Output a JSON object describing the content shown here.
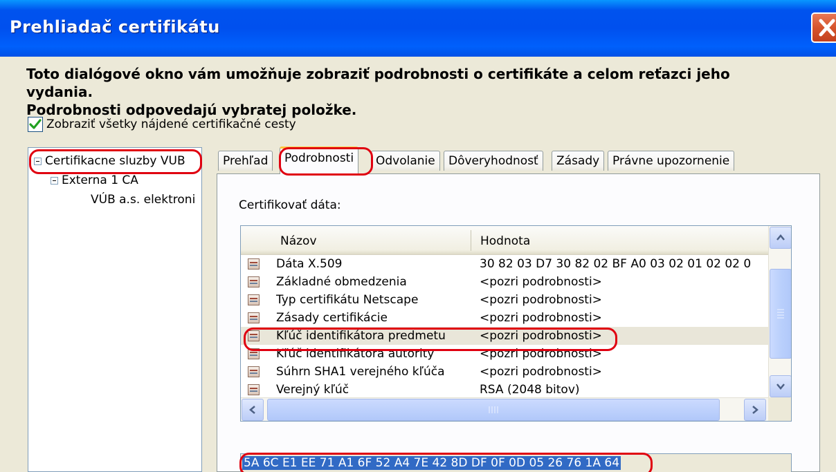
{
  "window": {
    "title": "Prehliadač certifikátu"
  },
  "description": {
    "line1": "Toto dialógové okno vám umožňuje zobraziť podrobnosti o certifikáte a celom reťazci jeho vydania.",
    "line2": "Podrobnosti odpovedajú vybratej položke."
  },
  "checkbox": {
    "label": "Zobraziť všetky nájdené certifikačné cesty",
    "checked": true
  },
  "tree": {
    "items": [
      {
        "label": "Certifikacne sluzby VUB"
      },
      {
        "label": "Externa 1 CA"
      },
      {
        "label": "VÚB a.s. elektroni"
      }
    ]
  },
  "tabs": [
    {
      "label": "Prehľad"
    },
    {
      "label": "Podrobnosti",
      "active": true
    },
    {
      "label": "Odvolanie"
    },
    {
      "label": "Dôveryhodnosť"
    },
    {
      "label": "Zásady"
    },
    {
      "label": "Právne upozornenie"
    }
  ],
  "details": {
    "section_label": "Certifikovať dáta:",
    "columns": {
      "name": "Názov",
      "value": "Hodnota"
    },
    "rows": [
      {
        "name": "Dáta X.509",
        "value": "30 82 03 D7 30 82 02 BF A0 03 02 01 02 02 0",
        "icon": "binary-data-icon"
      },
      {
        "name": "Základné obmedzenia",
        "value": "<pozri podrobnosti>",
        "icon": "critical-extension-icon"
      },
      {
        "name": "Typ certifikátu Netscape",
        "value": "<pozri podrobnosti>",
        "icon": "extension-icon"
      },
      {
        "name": "Zásady certifikácie",
        "value": "<pozri podrobnosti>",
        "icon": "extension-icon"
      },
      {
        "name": "Kľúč identifikátora predmetu",
        "value": "<pozri podrobnosti>",
        "icon": "extension-icon",
        "selected": true
      },
      {
        "name": "Kľúč identifikátora autority",
        "value": "<pozri podrobnosti>",
        "icon": "extension-icon"
      },
      {
        "name": "Súhrn SHA1 verejného kľúča",
        "value": "<pozri podrobnosti>",
        "icon": "field-icon"
      },
      {
        "name": "Verejný kľúč",
        "value": "RSA (2048 bitov)",
        "icon": "field-icon"
      }
    ],
    "field_value": "5A 6C E1 EE 71 A1 6F 52 A4 7E 42 8D DF 0F 0D 05 26 76 1A 64"
  },
  "colors": {
    "highlight": "#e00010",
    "titlebar": "#0053ee",
    "selection": "#316ac5"
  }
}
